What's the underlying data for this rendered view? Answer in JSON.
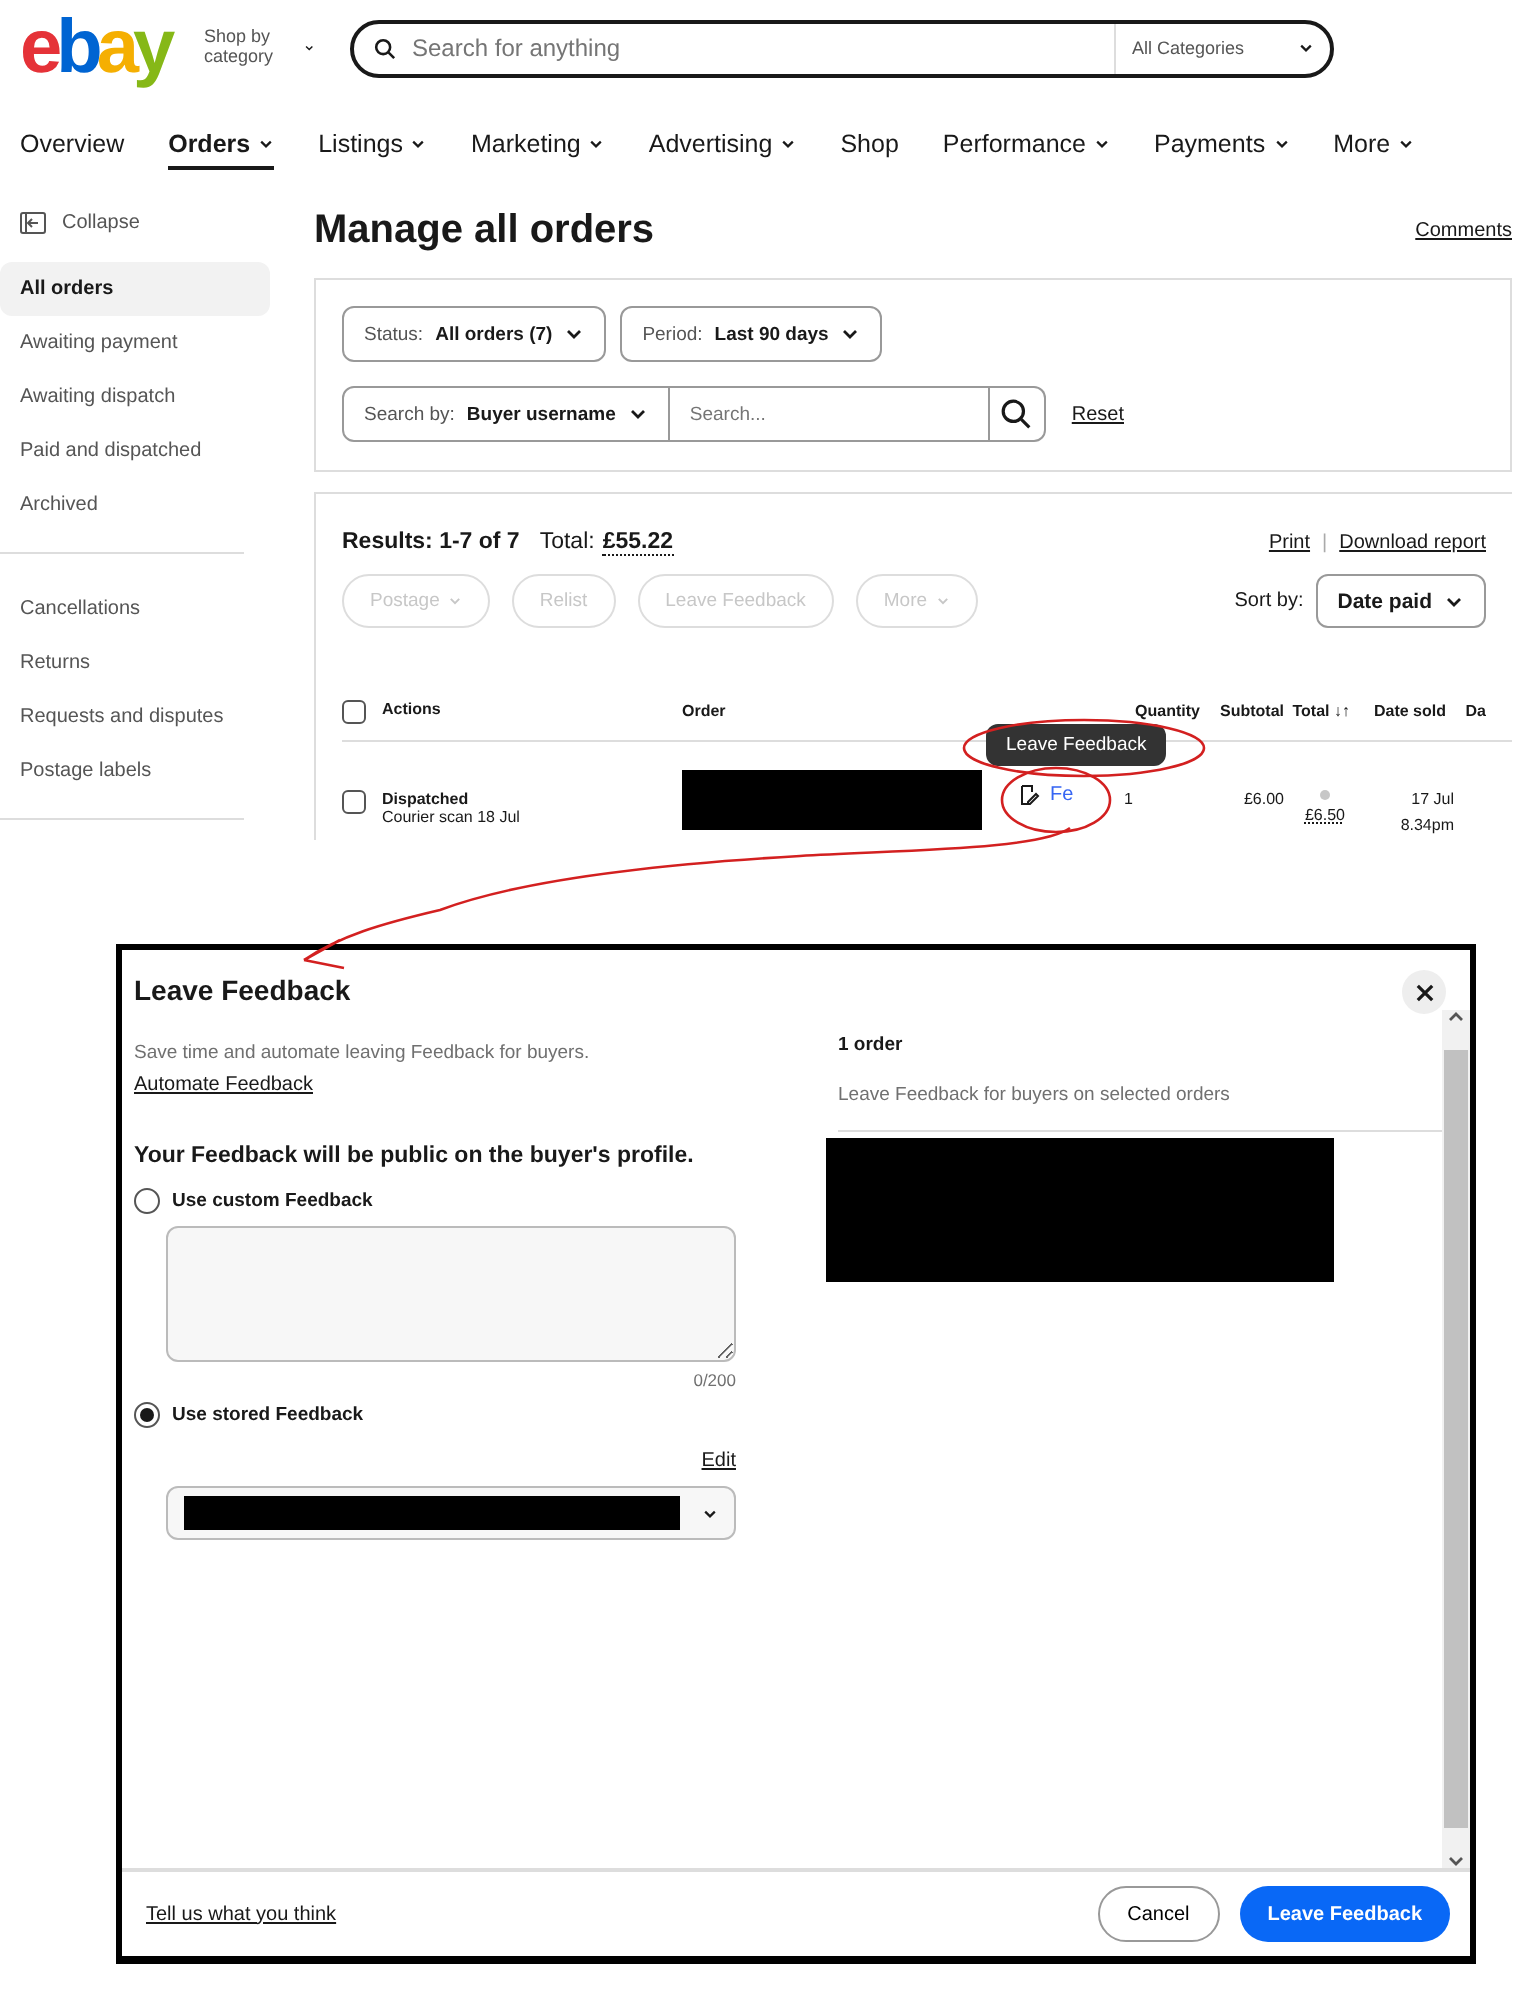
{
  "header": {
    "logo": "ebay",
    "shop_by": "Shop by category",
    "search_placeholder": "Search for anything",
    "category": "All Categories"
  },
  "nav": [
    {
      "label": "Overview",
      "dropdown": false,
      "selected": false
    },
    {
      "label": "Orders",
      "dropdown": true,
      "selected": true
    },
    {
      "label": "Listings",
      "dropdown": true,
      "selected": false
    },
    {
      "label": "Marketing",
      "dropdown": true,
      "selected": false
    },
    {
      "label": "Advertising",
      "dropdown": true,
      "selected": false
    },
    {
      "label": "Shop",
      "dropdown": false,
      "selected": false
    },
    {
      "label": "Performance",
      "dropdown": true,
      "selected": false
    },
    {
      "label": "Payments",
      "dropdown": true,
      "selected": false
    },
    {
      "label": "More",
      "dropdown": true,
      "selected": false
    }
  ],
  "sidebar": {
    "collapse": "Collapse",
    "groups": [
      [
        {
          "label": "All orders",
          "selected": true
        },
        {
          "label": "Awaiting payment",
          "selected": false
        },
        {
          "label": "Awaiting dispatch",
          "selected": false
        },
        {
          "label": "Paid and dispatched",
          "selected": false
        },
        {
          "label": "Archived",
          "selected": false
        }
      ],
      [
        {
          "label": "Cancellations",
          "selected": false
        },
        {
          "label": "Returns",
          "selected": false
        },
        {
          "label": "Requests and disputes",
          "selected": false
        },
        {
          "label": "Postage labels",
          "selected": false
        }
      ]
    ]
  },
  "page": {
    "title": "Manage all orders",
    "comments": "Comments"
  },
  "filters": {
    "dropdowns": [
      {
        "label": "Status:",
        "value": "All orders (7)"
      },
      {
        "label": "Period:",
        "value": "Last 90 days"
      }
    ],
    "search_by": {
      "label": "Search by:",
      "value": "Buyer username"
    },
    "search_placeholder": "Search...",
    "reset": "Reset"
  },
  "results": {
    "summary": "Results: 1-7 of 7",
    "total_label": "Total:",
    "total": "£55.22",
    "print": "Print",
    "separator": "|",
    "download": "Download report",
    "actions": [
      {
        "label": "Postage",
        "dropdown": true,
        "disabled": true
      },
      {
        "label": "Relist",
        "dropdown": false,
        "disabled": true
      },
      {
        "label": "Leave Feedback",
        "dropdown": false,
        "disabled": true
      },
      {
        "label": "More",
        "dropdown": true,
        "disabled": true
      }
    ],
    "sort_label": "Sort by:",
    "sort_value": "Date paid"
  },
  "table": {
    "select_all_checked": false,
    "columns": [
      "Actions",
      "Order",
      "Quantity",
      "Subtotal",
      "Total ↓↑",
      "Date sold",
      "Da"
    ],
    "rows": [
      {
        "checked": false,
        "status": "Dispatched",
        "tracking": "Courier scan 18 Jul",
        "feedback": "Fe",
        "quantity": "1",
        "subtotal": "£6.00",
        "total": "£6.50",
        "date": "17 Jul",
        "time": "8.34pm"
      }
    ]
  },
  "tooltip": "Leave Feedback",
  "dialog": {
    "title": "Leave Feedback",
    "intro": "Save time and automate leaving Feedback for buyers.",
    "automate": "Automate Feedback",
    "heading": "Your Feedback will be public on the buyer's profile.",
    "options": [
      {
        "label": "Use custom Feedback",
        "selected": false
      },
      {
        "label": "Use stored Feedback",
        "selected": true
      }
    ],
    "counter": "0/200",
    "edit": "Edit",
    "order_count": "1 order",
    "order_subtitle": "Leave Feedback for buyers on selected orders",
    "footer_link": "Tell us what you think",
    "cancel": "Cancel",
    "submit": "Leave Feedback"
  }
}
